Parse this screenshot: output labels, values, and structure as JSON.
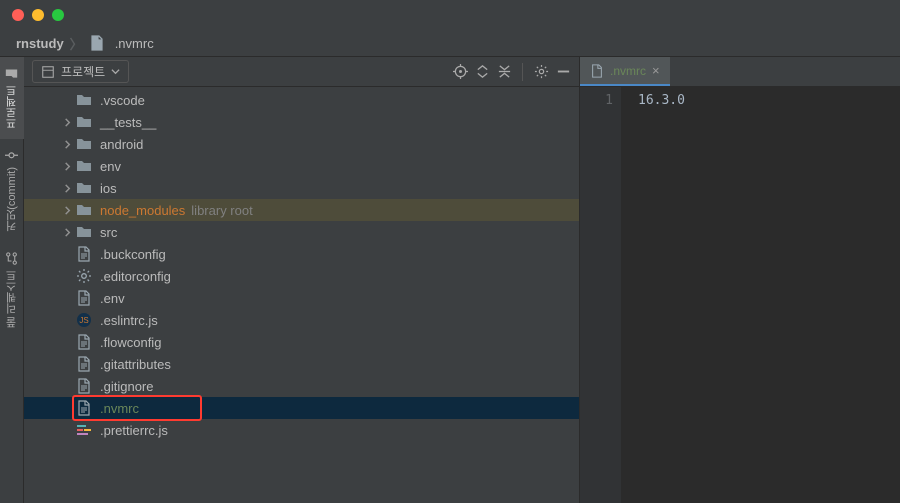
{
  "breadcrumb": {
    "root": "rnstudy",
    "file": ".nvmrc"
  },
  "sidebar": {
    "selector_label": "프로젝트",
    "truncated_root_path": "",
    "items": [
      {
        "label": ".vscode",
        "kind": "folder",
        "indent": 1,
        "chevron": false
      },
      {
        "label": "__tests__",
        "kind": "folder",
        "indent": 1,
        "chevron": true
      },
      {
        "label": "android",
        "kind": "folder",
        "indent": 1,
        "chevron": true
      },
      {
        "label": "env",
        "kind": "folder",
        "indent": 1,
        "chevron": true
      },
      {
        "label": "ios",
        "kind": "folder",
        "indent": 1,
        "chevron": true
      },
      {
        "label": "node_modules",
        "hint": "library root",
        "kind": "folder",
        "indent": 1,
        "chevron": true,
        "highlighted": true,
        "color": "orange"
      },
      {
        "label": "src",
        "kind": "folder",
        "indent": 1,
        "chevron": true
      },
      {
        "label": ".buckconfig",
        "kind": "file",
        "indent": 1,
        "chevron": false
      },
      {
        "label": ".editorconfig",
        "kind": "gear",
        "indent": 1,
        "chevron": false
      },
      {
        "label": ".env",
        "kind": "file",
        "indent": 1,
        "chevron": false
      },
      {
        "label": ".eslintrc.js",
        "kind": "js",
        "indent": 1,
        "chevron": false
      },
      {
        "label": ".flowconfig",
        "kind": "file",
        "indent": 1,
        "chevron": false
      },
      {
        "label": ".gitattributes",
        "kind": "file",
        "indent": 1,
        "chevron": false
      },
      {
        "label": ".gitignore",
        "kind": "file",
        "indent": 1,
        "chevron": false
      },
      {
        "label": ".nvmrc",
        "kind": "file",
        "indent": 1,
        "chevron": false,
        "selected": true,
        "color": "green",
        "boxed": true
      },
      {
        "label": ".prettierrc.js",
        "kind": "js-pretty",
        "indent": 1,
        "chevron": false
      }
    ]
  },
  "rail": {
    "tabs": [
      {
        "label": "프로젝트",
        "active": true
      },
      {
        "label": "커밋(commit)",
        "active": false
      },
      {
        "label": "풀 리퀘스트",
        "active": false
      }
    ]
  },
  "editor": {
    "tab": ".nvmrc",
    "line_number": "1",
    "content": "16.3.0"
  }
}
